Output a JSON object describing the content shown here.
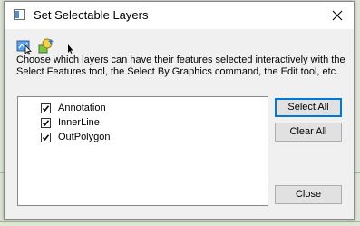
{
  "window": {
    "title": "Set Selectable Layers"
  },
  "toolbar": {
    "icons": [
      "select-features-icon",
      "select-by-graphics-icon",
      "pointer-arrow-icon"
    ]
  },
  "description": "Choose which layers can have their features selected interactively with the Select Features tool, the Select By Graphics command, the Edit tool, etc.",
  "layers": [
    {
      "label": "Annotation",
      "checked": true
    },
    {
      "label": "InnerLine",
      "checked": true
    },
    {
      "label": "OutPolygon",
      "checked": true
    }
  ],
  "buttons": {
    "select_all": "Select All",
    "clear_all": "Clear All",
    "close": "Close"
  },
  "colors": {
    "accent": "#0078d7",
    "window_bg": "#f0f0f0",
    "titlebar_bg": "#ffffff"
  }
}
